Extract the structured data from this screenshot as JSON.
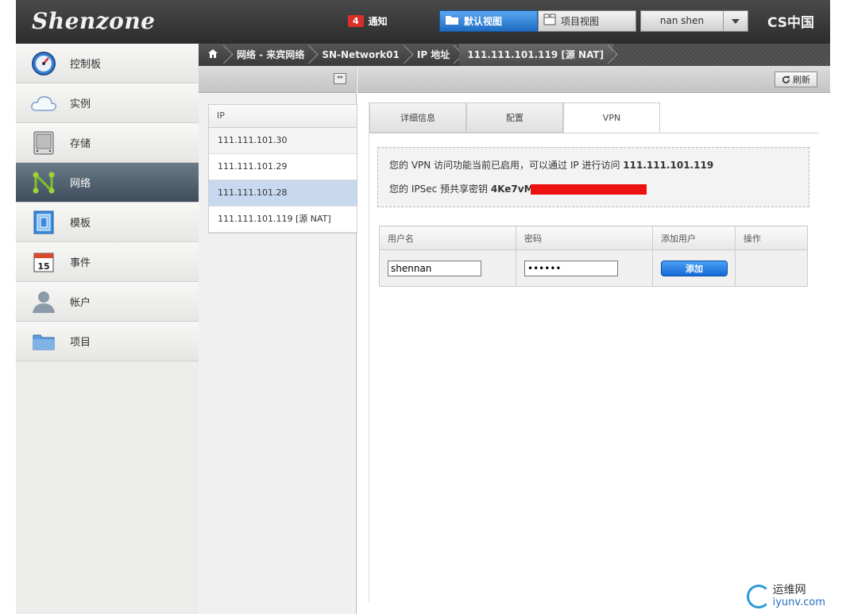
{
  "header": {
    "logo": "Shenzone",
    "notification_count": "4",
    "notification_label": "通知",
    "views": [
      {
        "label": "默认视图",
        "active": true
      },
      {
        "label": "项目视图",
        "active": false
      }
    ],
    "user_name": "nan shen",
    "brand_right": "CS中国"
  },
  "sidebar": {
    "items": [
      {
        "label": "控制板",
        "icon": "dashboard-icon"
      },
      {
        "label": "实例",
        "icon": "cloud-icon"
      },
      {
        "label": "存储",
        "icon": "storage-icon"
      },
      {
        "label": "网络",
        "icon": "network-icon",
        "active": true
      },
      {
        "label": "模板",
        "icon": "template-icon"
      },
      {
        "label": "事件",
        "icon": "calendar-icon"
      },
      {
        "label": "帐户",
        "icon": "account-icon"
      },
      {
        "label": "项目",
        "icon": "folder-icon"
      }
    ]
  },
  "breadcrumb": {
    "items": [
      "网络 - 来宾网络",
      "SN-Network01",
      "IP 地址",
      "111.111.101.119 [源 NAT]"
    ]
  },
  "ip_list": {
    "header": "IP",
    "rows": [
      "111.111.101.30",
      "111.111.101.29",
      "111.111.101.28",
      "111.111.101.119 [源 NAT]"
    ]
  },
  "toolbar": {
    "refresh_label": "刷新"
  },
  "tabs": [
    {
      "label": "详细信息"
    },
    {
      "label": "配置"
    },
    {
      "label": "VPN",
      "active": true
    }
  ],
  "vpn": {
    "line1_prefix": "您的 VPN 访问功能当前已启用，可以通过 IP 进行访问",
    "line1_ip": "111.111.101.119",
    "line2_prefix": "您的 IPSec 预共享密钥",
    "line2_key": "4Ke7vM"
  },
  "user_table": {
    "headers": [
      "用户名",
      "密码",
      "添加用户",
      "操作"
    ],
    "username_value": "shennan",
    "password_value": "••••••",
    "add_button": "添加"
  },
  "watermark": {
    "line1": "运维网",
    "line2": "iyunv.com"
  }
}
